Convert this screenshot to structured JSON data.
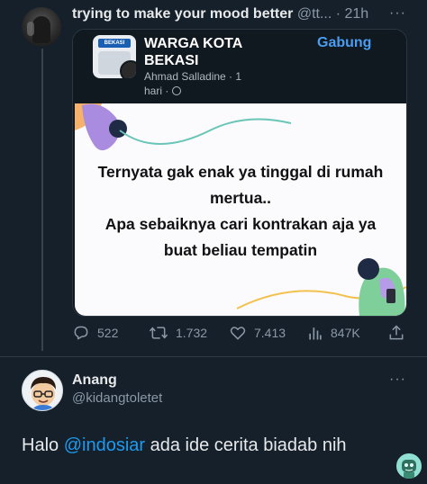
{
  "top_tweet": {
    "display_name": "trying to make your mood better",
    "handle_time": " @tt... · 21h",
    "card": {
      "group_name": "WARGA KOTA BEKASI",
      "author": "Ahmad Salladine · 1",
      "time": "hari · ",
      "join_label": "Gabung",
      "logo_text": "BEKASI",
      "image_text_lines": [
        "Ternyata gak enak ya tinggal di rumah",
        "mertua..",
        "Apa sebaiknya cari kontrakan aja ya",
        "buat beliau tempatin"
      ]
    },
    "actions": {
      "replies": "522",
      "retweets": "1.732",
      "likes": "7.413",
      "views": "847K"
    }
  },
  "reply_tweet": {
    "display_name": "Anang",
    "handle": "@kidangtoletet",
    "text_before": "Halo ",
    "mention": "@indosiar",
    "text_after": " ada ide cerita biadab nih"
  },
  "more_label": "···"
}
